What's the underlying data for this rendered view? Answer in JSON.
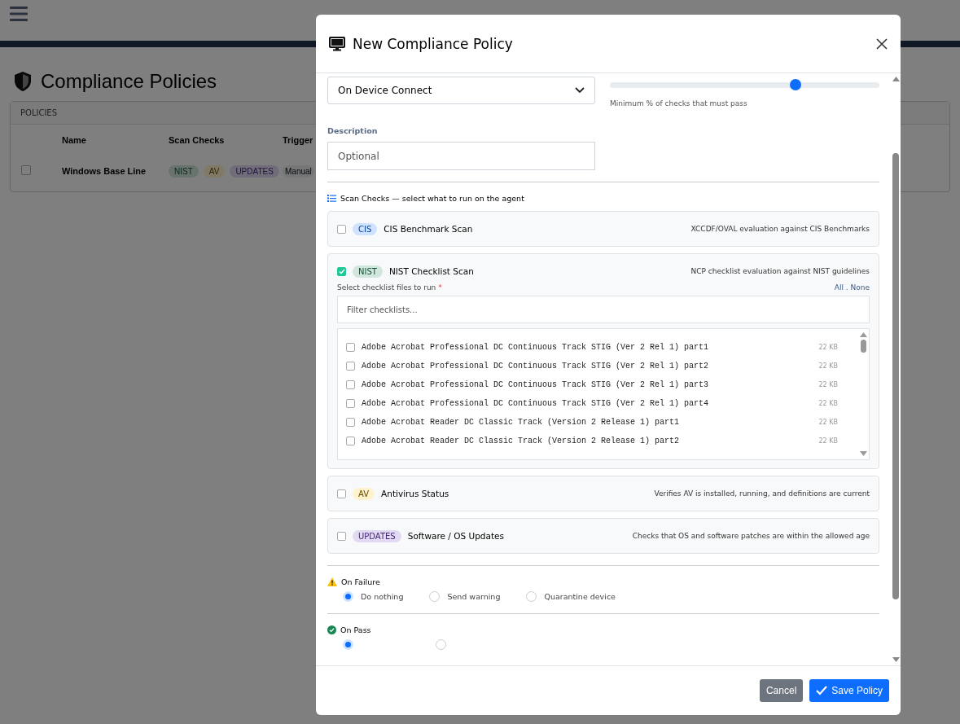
{
  "page": {
    "title": "Compliance Policies",
    "card_header": "POLICIES",
    "columns": [
      "Name",
      "Scan Checks",
      "Trigger"
    ],
    "rows": [
      {
        "name": "Windows Base Line",
        "checked": false,
        "tags": [
          {
            "label": "NIST",
            "kind": "nist"
          },
          {
            "label": "AV",
            "kind": "av"
          },
          {
            "label": "UPDATES",
            "kind": "updates"
          }
        ],
        "trigger": "Manual"
      }
    ]
  },
  "modal": {
    "title": "New Compliance Policy",
    "trigger_select": {
      "value": "On Device Connect"
    },
    "threshold": {
      "level": 0.69,
      "hint": "Minimum % of checks that must pass"
    },
    "description": {
      "label": "Description",
      "placeholder": "Optional"
    },
    "scan_heading": "Scan Checks — select what to run on the agent",
    "checks": [
      {
        "tag": "CIS",
        "color": "#cfe2ff",
        "name": "CIS Benchmark Scan",
        "desc": "XCCDF/OVAL evaluation against CIS Benchmarks",
        "checked": false
      },
      {
        "tag": "NIST",
        "color": "#d1e7dd",
        "name": "NIST Checklist Scan",
        "desc": "NCP checklist evaluation against NIST guidelines",
        "checked": true,
        "files_label": "Select checklist files to run",
        "required": "*",
        "all": "All",
        "sep": ".",
        "none": "None",
        "filter_placeholder": "Filter checklists...",
        "files": [
          {
            "name": "Adobe Acrobat Professional DC Continuous Track STIG (Ver 2 Rel 1) part1",
            "size": "22 KB",
            "checked": false
          },
          {
            "name": "Adobe Acrobat Professional DC Continuous Track STIG (Ver 2 Rel 1) part2",
            "size": "22 KB",
            "checked": false
          },
          {
            "name": "Adobe Acrobat Professional DC Continuous Track STIG (Ver 2 Rel 1) part3",
            "size": "22 KB",
            "checked": false
          },
          {
            "name": "Adobe Acrobat Professional DC Continuous Track STIG (Ver 2 Rel 1) part4",
            "size": "22 KB",
            "checked": false
          },
          {
            "name": "Adobe Acrobat Reader DC Classic Track (Version 2 Release 1) part1",
            "size": "22 KB",
            "checked": false
          },
          {
            "name": "Adobe Acrobat Reader DC Classic Track (Version 2 Release 1) part2",
            "size": "22 KB",
            "checked": false
          }
        ]
      },
      {
        "tag": "AV",
        "color": "#fff3cd",
        "name": "Antivirus Status",
        "desc": "Verifies AV is installed, running, and definitions are current",
        "checked": false
      },
      {
        "tag": "UPDATES",
        "color": "#e2d9f3",
        "name": "Software / OS Updates",
        "desc": "Checks that OS and software patches are within the allowed age",
        "checked": false
      }
    ],
    "on_failure": {
      "label": "On Failure",
      "options": [
        {
          "label": "Do nothing",
          "selected": true
        },
        {
          "label": "Send warning",
          "selected": false
        },
        {
          "label": "Quarantine device",
          "selected": false
        }
      ]
    },
    "on_pass": {
      "label": "On Pass",
      "options": [
        {
          "selected": true
        },
        {
          "selected": false
        }
      ]
    },
    "buttons": {
      "cancel": "Cancel",
      "save": "Save Policy"
    }
  }
}
